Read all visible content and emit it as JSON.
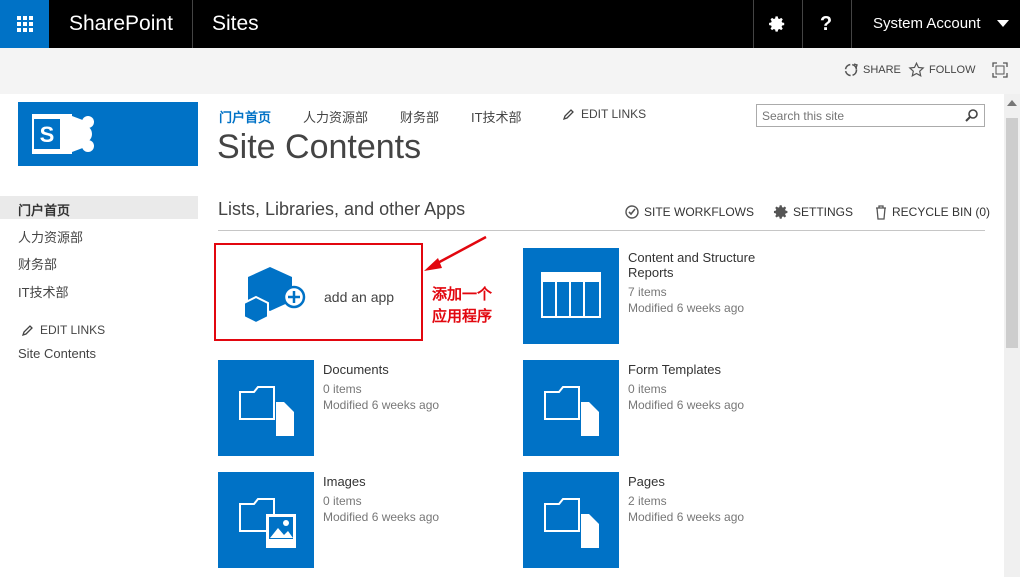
{
  "suitebar": {
    "product": "SharePoint",
    "app": "Sites",
    "user": "System Account",
    "settings_icon": "gear-icon",
    "help_label": "?"
  },
  "ribbon": {
    "share": "SHARE",
    "follow": "FOLLOW"
  },
  "topnav": {
    "items": [
      "门户首页",
      "人力资源部",
      "财务部",
      "IT技术部"
    ],
    "edit_links": "EDIT LINKS"
  },
  "search": {
    "placeholder": "Search this site"
  },
  "page": {
    "title": "Site Contents"
  },
  "leftnav": {
    "items": [
      "门户首页",
      "人力资源部",
      "财务部",
      "IT技术部"
    ],
    "edit_links": "EDIT LINKS",
    "site_contents": "Site Contents"
  },
  "section": {
    "title": "Lists, Libraries, and other Apps",
    "site_workflows": "SITE WORKFLOWS",
    "settings": "SETTINGS",
    "recycle_bin": "RECYCLE BIN (0)"
  },
  "add_app": {
    "label": "add an app"
  },
  "annotation": {
    "line1": "添加一个",
    "line2": "应用程序"
  },
  "apps": [
    {
      "title": "Content and Structure Reports",
      "items": "7 items",
      "modified": "Modified 6 weeks ago"
    },
    {
      "title": "Documents",
      "items": "0 items",
      "modified": "Modified 6 weeks ago"
    },
    {
      "title": "Form Templates",
      "items": "0 items",
      "modified": "Modified 6 weeks ago"
    },
    {
      "title": "Images",
      "items": "0 items",
      "modified": "Modified 6 weeks ago"
    },
    {
      "title": "Pages",
      "items": "2 items",
      "modified": "Modified 6 weeks ago"
    }
  ],
  "colors": {
    "brand_blue": "#0072c6",
    "annotation_red": "#e2070f",
    "suitebar_black": "#000000"
  }
}
